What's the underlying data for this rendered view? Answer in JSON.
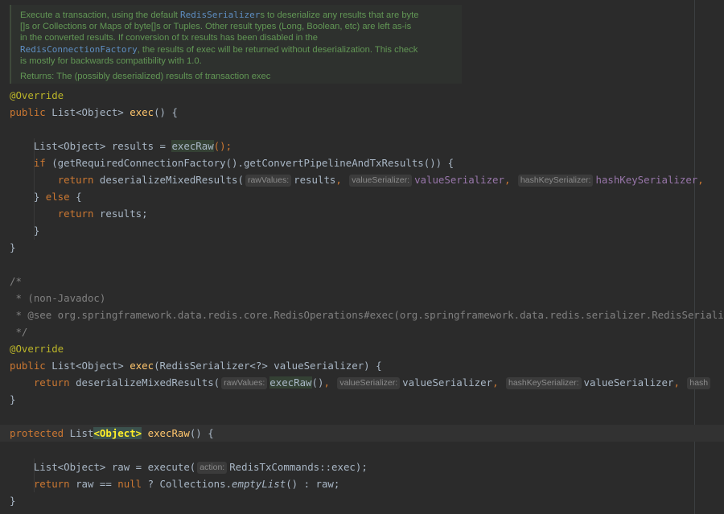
{
  "doc": {
    "line1_a": "Execute a transaction, using the default ",
    "line1_code": "RedisSerializer",
    "line1_b": "s to deserialize any results that are byte",
    "line2": "[]s or Collections or Maps of byte[]s or Tuples. Other result types (Long, Boolean, etc) are left as-is",
    "line3": "in the converted results. If conversion of tx results has been disabled in the",
    "line4_code": "RedisConnectionFactory",
    "line4_b": ", the results of exec will be returned without deserialization. This check",
    "line5": "is mostly for backwards compatibility with 1.0.",
    "returns": "Returns: The (possibly deserialized) results of transaction exec"
  },
  "code": {
    "override": "@Override",
    "public": "public",
    "protected": "protected",
    "return": "return",
    "if": "if",
    "else": "else",
    "null": "null",
    "list_type": "List<Object>",
    "list": "List",
    "object_generic": "<Object>",
    "exec": "exec",
    "exec_raw": "execRaw",
    "results": "results",
    "raw": "raw",
    "open_sig": "() {",
    "close_brace": "}",
    "l1_assign": " results = ",
    "l1_tail": "();",
    "l2_open": " (getRequiredConnectionFactory().getConvertPipelineAndTxResults()) {",
    "deserialize": "deserializeMixedResults(",
    "hint_raw_values": "rawValues:",
    "hint_value_serializer": "valueSerializer:",
    "hint_hashkey_serializer": "hashKeySerializer:",
    "hint_action": "action:",
    "hint_hash_cut": "hash",
    "results_arg": "results",
    "value_serializer": "valueSerializer",
    "hashkey_serializer": "hashKeySerializer",
    "comma": ", ",
    "else_open_a": "} ",
    "else_open_b": " {",
    "results_stmt": " results;",
    "comment_open": "/*",
    "comment_nonjavadoc": " * (non-Javadoc)",
    "comment_see": " * @see org.springframework.data.redis.core.RedisOperations#exec(org.springframework.data.redis.serializer.RedisSerialize",
    "comment_close": " */",
    "exec_param": "(RedisSerializer<?> valueSerializer) {",
    "exec_raw_call": "()",
    "raw_assign": " raw = execute(",
    "tx_commands": "RedisTxCommands::exec);",
    "raw_check": " raw == ",
    "ternary": " ? Collections.",
    "empty_list": "emptyList",
    "ternary_end": "() : raw;"
  }
}
